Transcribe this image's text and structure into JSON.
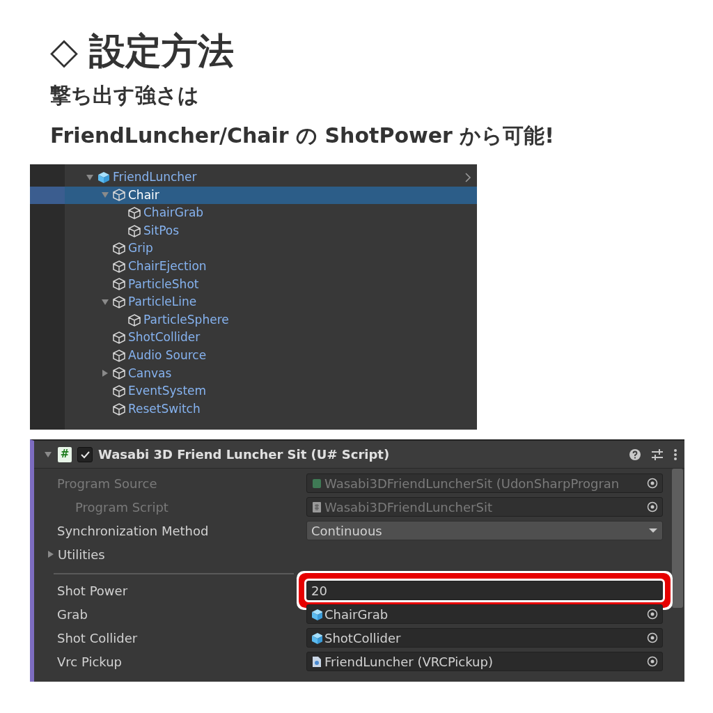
{
  "heading": {
    "symbol": "◇",
    "text": "設定方法"
  },
  "lines": [
    "撃ち出す強さは",
    "FriendLuncher/Chair の ShotPower から可能!"
  ],
  "hierarchy": {
    "items": [
      {
        "name": "FriendLuncher",
        "kind": "prefab",
        "expanded": true,
        "selected": false,
        "children": [
          {
            "name": "Chair",
            "kind": "object",
            "expanded": true,
            "selected": true,
            "children": [
              {
                "name": "ChairGrab",
                "kind": "object",
                "selected": false
              },
              {
                "name": "SitPos",
                "kind": "object",
                "selected": false
              }
            ]
          },
          {
            "name": "Grip",
            "kind": "object",
            "selected": false
          },
          {
            "name": "ChairEjection",
            "kind": "object",
            "selected": false
          },
          {
            "name": "ParticleShot",
            "kind": "object",
            "selected": false
          },
          {
            "name": "ParticleLine",
            "kind": "object",
            "expanded": true,
            "selected": false,
            "children": [
              {
                "name": "ParticleSphere",
                "kind": "object",
                "selected": false
              }
            ]
          },
          {
            "name": "ShotCollider",
            "kind": "object",
            "selected": false
          },
          {
            "name": "Audio Source",
            "kind": "object",
            "selected": false
          },
          {
            "name": "Canvas",
            "kind": "object",
            "expanded": false,
            "selected": false
          },
          {
            "name": "EventSystem",
            "kind": "object",
            "selected": false
          },
          {
            "name": "ResetSwitch",
            "kind": "object",
            "selected": false
          }
        ]
      }
    ]
  },
  "inspector": {
    "component": {
      "icon_glyph": "#",
      "enabled": true,
      "expanded": true,
      "title": "Wasabi 3D Friend Luncher Sit (U# Script)"
    },
    "fields": [
      {
        "kind": "asset",
        "label": "Program Source",
        "value": "Wasabi3DFriendLuncherSit (UdonSharpProgran",
        "disabled": true,
        "indented": false
      },
      {
        "kind": "script",
        "label": "Program Script",
        "value": "Wasabi3DFriendLuncherSit",
        "disabled": true,
        "indented": true
      },
      {
        "kind": "dropdown",
        "label": "Synchronization Method",
        "value": "Continuous",
        "disabled": false,
        "indented": false
      },
      {
        "kind": "foldout",
        "label": "Utilities",
        "expanded": false
      },
      {
        "kind": "number",
        "label": "Shot Power",
        "value": "20",
        "highlighted": true,
        "disabled": false,
        "indented": false
      },
      {
        "kind": "gameobject",
        "label": "Grab",
        "value": "ChairGrab",
        "disabled": false,
        "indented": false
      },
      {
        "kind": "gameobject",
        "label": "Shot Collider",
        "value": "ShotCollider",
        "disabled": false,
        "indented": false
      },
      {
        "kind": "component",
        "label": "Vrc Pickup",
        "value": "FriendLuncher (VRCPickup)",
        "disabled": false,
        "indented": false
      }
    ]
  }
}
